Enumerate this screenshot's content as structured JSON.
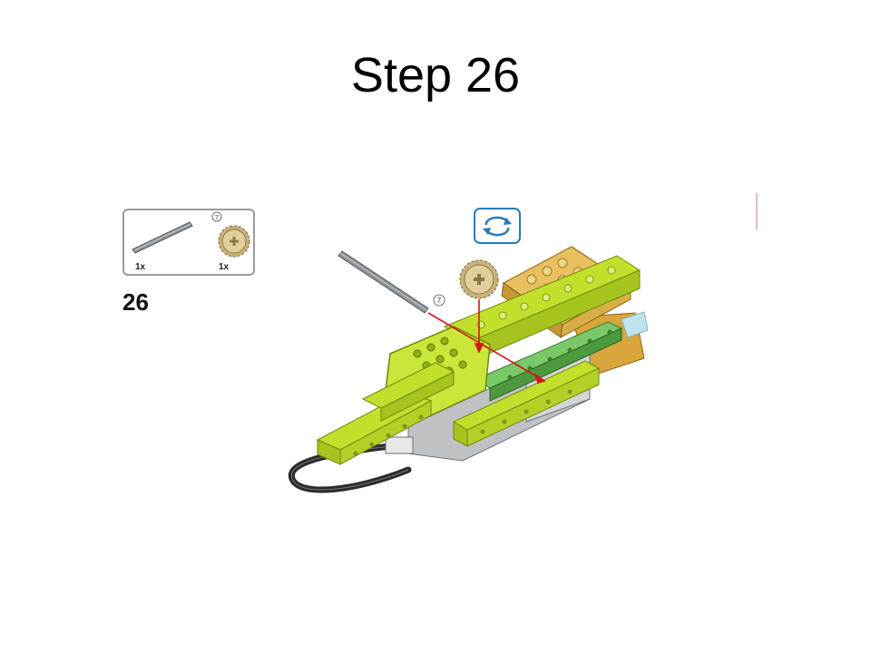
{
  "slide": {
    "title": "Step 26"
  },
  "parts_callout": {
    "axle": {
      "qty": "1x",
      "length_label": "7",
      "icon": "axle-icon"
    },
    "gear": {
      "qty": "1x",
      "icon": "gear-24-tooth-icon"
    }
  },
  "step": {
    "number": "26"
  },
  "assembly": {
    "axle_length_label": "7",
    "rotate_icon": "rotate-model-icon"
  },
  "colors": {
    "lime": "#c2df2c",
    "lime_dark": "#8fb114",
    "tan": "#e8c060",
    "tan_dark": "#c49a36",
    "green": "#6fc25a",
    "grey_axle": "#8e9398",
    "gear": "#d8c79a",
    "guide_arrow": "#d21414",
    "rotate_blue": "#2a7ab8"
  }
}
